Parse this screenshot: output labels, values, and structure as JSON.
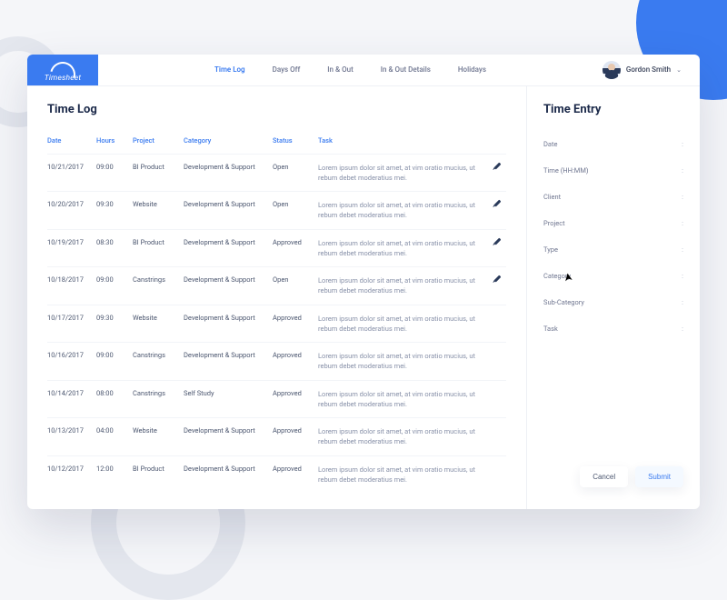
{
  "brand": "Timesheet",
  "nav": {
    "items": [
      {
        "label": "Time Log",
        "active": true
      },
      {
        "label": "Days Off",
        "active": false
      },
      {
        "label": "In & Out",
        "active": false
      },
      {
        "label": "In & Out Details",
        "active": false
      },
      {
        "label": "Holidays",
        "active": false
      }
    ]
  },
  "user": {
    "name": "Gordon Smith"
  },
  "main": {
    "title": "Time Log",
    "columns": {
      "date": "Date",
      "hours": "Hours",
      "project": "Project",
      "category": "Category",
      "status": "Status",
      "task": "Task"
    },
    "rows": [
      {
        "date": "10/21/2017",
        "hours": "09:00",
        "project": "BI Product",
        "category": "Development & Support",
        "status": "Open",
        "task": "Lorem ipsum dolor sit amet, at vim oratio mucius, ut rebum debet moderatius mei.",
        "editable": true
      },
      {
        "date": "10/20/2017",
        "hours": "09:30",
        "project": "Website",
        "category": "Development & Support",
        "status": "Open",
        "task": "Lorem ipsum dolor sit amet, at vim oratio mucius, ut rebum debet moderatius mei.",
        "editable": true
      },
      {
        "date": "10/19/2017",
        "hours": "08:30",
        "project": "BI Product",
        "category": "Development & Support",
        "status": "Approved",
        "task": "Lorem ipsum dolor sit amet, at vim oratio mucius, ut rebum debet moderatius mei.",
        "editable": true
      },
      {
        "date": "10/18/2017",
        "hours": "09:00",
        "project": "Canstrings",
        "category": "Development & Support",
        "status": "Open",
        "task": "Lorem ipsum dolor sit amet, at vim oratio mucius, ut rebum debet moderatius mei.",
        "editable": true
      },
      {
        "date": "10/17/2017",
        "hours": "09:30",
        "project": "Website",
        "category": "Development & Support",
        "status": "Approved",
        "task": "Lorem ipsum dolor sit amet, at vim oratio mucius, ut rebum debet moderatius mei.",
        "editable": false
      },
      {
        "date": "10/16/2017",
        "hours": "09:00",
        "project": "Canstrings",
        "category": "Development & Support",
        "status": "Approved",
        "task": "Lorem ipsum dolor sit amet, at vim oratio mucius, ut rebum debet moderatius mei.",
        "editable": false
      },
      {
        "date": "10/14/2017",
        "hours": "08:00",
        "project": "Canstrings",
        "category": "Self Study",
        "status": "Approved",
        "task": "Lorem ipsum dolor sit amet, at vim oratio mucius, ut rebum debet moderatius mei.",
        "editable": false
      },
      {
        "date": "10/13/2017",
        "hours": "04:00",
        "project": "Website",
        "category": "Development & Support",
        "status": "Approved",
        "task": "Lorem ipsum dolor sit amet, at vim oratio mucius, ut rebum debet moderatius mei.",
        "editable": false
      },
      {
        "date": "10/12/2017",
        "hours": "12:00",
        "project": "BI Product",
        "category": "Development & Support",
        "status": "Approved",
        "task": "Lorem ipsum dolor sit amet, at vim oratio mucius, ut rebum debet moderatius mei.",
        "editable": false
      }
    ]
  },
  "side": {
    "title": "Time Entry",
    "fields": [
      {
        "label": "Date"
      },
      {
        "label": "Time (HH:MM)"
      },
      {
        "label": "Client"
      },
      {
        "label": "Project"
      },
      {
        "label": "Type"
      },
      {
        "label": "Category"
      },
      {
        "label": "Sub-Category"
      },
      {
        "label": "Task"
      }
    ],
    "cancel": "Cancel",
    "submit": "Submit"
  }
}
